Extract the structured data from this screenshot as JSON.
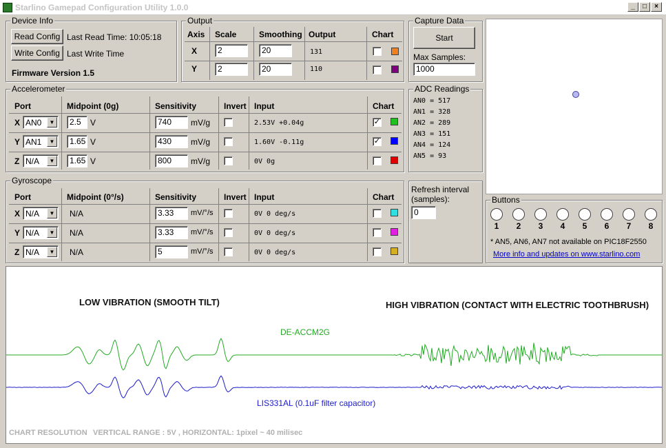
{
  "window": {
    "title": "Starlino Gamepad Configuration Utility 1.0.0"
  },
  "device_info": {
    "label": "Device Info",
    "read_button": "Read Config",
    "write_button": "Write Config",
    "last_read": "Last Read Time: 10:05:18",
    "last_write": "Last Write Time",
    "firmware": "Firmware Version 1.5"
  },
  "output": {
    "label": "Output",
    "headers": [
      "Axis",
      "Scale",
      "Smoothing",
      "Output",
      "Chart"
    ],
    "rows": [
      {
        "axis": "X",
        "scale": "2",
        "smoothing": "20",
        "output": "131",
        "chart": false,
        "color": "#f08020"
      },
      {
        "axis": "Y",
        "scale": "2",
        "smoothing": "20",
        "output": "110",
        "chart": false,
        "color": "#800080"
      }
    ]
  },
  "capture": {
    "label": "Capture Data",
    "start_button": "Start",
    "max_samples_label": "Max Samples:",
    "max_samples": "1000"
  },
  "accelerometer": {
    "label": "Accelerometer",
    "headers": [
      "Port",
      "Midpoint (0g)",
      "Sensitivity",
      "Invert",
      "Input",
      "Chart"
    ],
    "rows": [
      {
        "axis": "X",
        "port": "AN0",
        "midpoint": "2.5",
        "mid_unit": "V",
        "sensitivity": "740",
        "sens_unit": "mV/g",
        "invert": false,
        "input": "2.53V +0.04g",
        "chart": true,
        "color": "#20c020"
      },
      {
        "axis": "Y",
        "port": "AN1",
        "midpoint": "1.65",
        "mid_unit": "V",
        "sensitivity": "430",
        "sens_unit": "mV/g",
        "invert": false,
        "input": "1.60V -0.11g",
        "chart": true,
        "color": "#0000ff"
      },
      {
        "axis": "Z",
        "port": "N/A",
        "midpoint": "1.65",
        "mid_unit": "V",
        "sensitivity": "800",
        "sens_unit": "mV/g",
        "invert": false,
        "input": "0V 0g",
        "chart": false,
        "color": "#e00000"
      }
    ]
  },
  "adc": {
    "label": "ADC Readings",
    "values": [
      "AN0 = 517",
      "AN1 = 328",
      "AN2 = 289",
      "AN3 = 151",
      "AN4 = 124",
      "AN5 = 93"
    ]
  },
  "gyroscope": {
    "label": "Gyroscope",
    "headers": [
      "Port",
      "Midpoint (0°/s)",
      "Sensitivity",
      "Invert",
      "Input",
      "Chart"
    ],
    "rows": [
      {
        "axis": "X",
        "port": "N/A",
        "midpoint": "N/A",
        "sensitivity": "3.33",
        "sens_unit": "mV/°/s",
        "invert": false,
        "input": "0V 0 deg/s",
        "chart": false,
        "color": "#30e0e0"
      },
      {
        "axis": "Y",
        "port": "N/A",
        "midpoint": "N/A",
        "sensitivity": "3.33",
        "sens_unit": "mV/°/s",
        "invert": false,
        "input": "0V 0 deg/s",
        "chart": false,
        "color": "#e020e0"
      },
      {
        "axis": "Z",
        "port": "N/A",
        "midpoint": "N/A",
        "sensitivity": "5",
        "sens_unit": "mV/°/s",
        "invert": false,
        "input": "0V 0 deg/s",
        "chart": false,
        "color": "#d4b020"
      }
    ]
  },
  "refresh": {
    "label": "Refresh interval\n(samples):",
    "value": "0"
  },
  "buttons": {
    "label": "Buttons",
    "numbers": [
      "1",
      "2",
      "3",
      "4",
      "5",
      "6",
      "7",
      "8"
    ],
    "note": "* AN5, AN6, AN7 not available on PIC18F2550",
    "link": "More info and updates on www.starlino.com"
  },
  "chart": {
    "left_caption": "LOW VIBRATION (SMOOTH TILT)",
    "right_caption": "HIGH VIBRATION (CONTACT WITH ELECTRIC TOOTHBRUSH)",
    "green_label": "DE-ACCM2G",
    "blue_label": "LIS331AL (0.1uF filter capacitor)",
    "resolution_label": "CHART RESOLUTION",
    "range_label": "VERTICAL RANGE : 5V , HORIZONTAL: 1pixel ~ 40 milisec",
    "green_color": "#22aa22",
    "blue_color": "#1a1acc"
  }
}
